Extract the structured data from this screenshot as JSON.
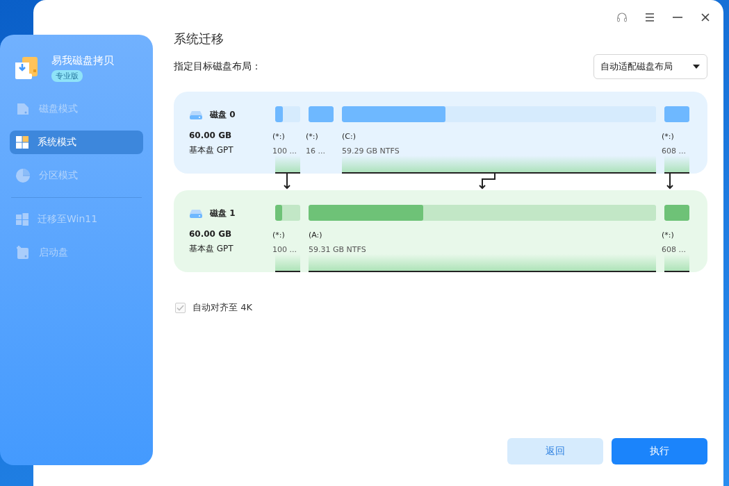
{
  "app": {
    "name": "易我磁盘拷贝",
    "edition": "专业版"
  },
  "sidebar": {
    "items": [
      {
        "label": "磁盘模式",
        "selected": false,
        "disabled": true
      },
      {
        "label": "系统模式",
        "selected": true,
        "disabled": false
      },
      {
        "label": "分区模式",
        "selected": false,
        "disabled": true
      },
      {
        "label": "迁移至Win11",
        "selected": false,
        "disabled": true,
        "divider_before": true
      },
      {
        "label": "启动盘",
        "selected": false,
        "disabled": true
      }
    ]
  },
  "page": {
    "title": "系统迁移",
    "layout_label": "指定目标磁盘布局：",
    "layout_dropdown": "自动适配磁盘布局"
  },
  "disks": [
    {
      "kind": "source",
      "name": "磁盘 0",
      "capacity": "60.00 GB",
      "type": "基本盘 GPT",
      "partitions": [
        {
          "kind": "minor",
          "letter": "(*:)",
          "size": "100 ...",
          "level": 0.3,
          "mapped": true
        },
        {
          "kind": "minor",
          "letter": "(*:)",
          "size": "16 ...",
          "level": 1,
          "mapped": false
        },
        {
          "kind": "main",
          "letter": "(C:)",
          "size": "59.29 GB NTFS",
          "level": 0.33,
          "mapped": true
        },
        {
          "kind": "minor",
          "letter": "(*:)",
          "size": "608 ...",
          "level": 1,
          "mapped": true
        }
      ]
    },
    {
      "kind": "target",
      "name": "磁盘 1",
      "capacity": "60.00 GB",
      "type": "基本盘 GPT",
      "partitions": [
        {
          "kind": "minor",
          "letter": "(*:)",
          "size": "100 ...",
          "level": 0.27,
          "mapped": true
        },
        {
          "kind": "main",
          "letter": "(A:)",
          "size": "59.31 GB NTFS",
          "level": 0.33,
          "mapped": true
        },
        {
          "kind": "minor",
          "letter": "(*:)",
          "size": "608 ...",
          "level": 1,
          "mapped": true
        }
      ]
    }
  ],
  "align_4k": {
    "label": "自动对齐至 4K",
    "checked": true,
    "disabled": true
  },
  "buttons": [
    {
      "kind": "secondary",
      "label": "返回"
    },
    {
      "kind": "primary",
      "label": "执行"
    }
  ]
}
